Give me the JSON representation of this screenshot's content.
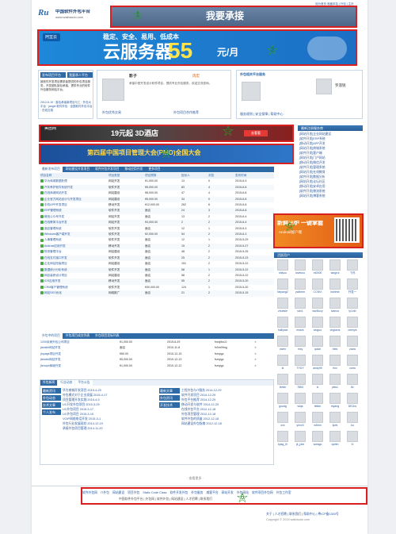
{
  "site": {
    "name": "中国软件外包平台",
    "domain": "www.waibaodo.com",
    "toplinks": "设为首页 收藏本站 | 外包 | 主页"
  },
  "ads": {
    "top_slogan": "我要承接",
    "cloud_brand": "阿里云",
    "cloud_tagline": "稳定、安全、易用、低成本",
    "cloud_main": "云服务器",
    "cloud_price": "55",
    "cloud_unit": "元/月",
    "banner1_brand": "美团网",
    "banner1_text": "19元起 3D酒店",
    "banner1_button": "去看看",
    "banner2_text": "第四届中国项目管理大会(PMO)全国大会",
    "side_ad_title": "新鲜出炉 一键掌握",
    "side_ad_sub": "Android客户端"
  },
  "left_intro": {
    "publish_button": "发布项目平台",
    "join_button": "我要承人平台",
    "intro_text": "致软件开发项目需求者提供的外包项目服务，开发团队接包承接，提供专业的软件外包服务网站平台。",
    "news_text": "2012-5-19 · 各包承接新项目与工 · 外包大平台 · jangel 软件外包 · 全国软件外包平台 · 在线交易"
  },
  "profile": {
    "title": "影子",
    "badge": "肉宏",
    "summary": "承接中型开发设计软件项目，提供专业外包服务，欢迎交流咨询。",
    "subtitle": "外包优秀交易",
    "subtitle2": "外包项目合作推荐"
  },
  "right_panel": {
    "header": "外包相关平台服务",
    "user_name": "罗淑锐",
    "footer_links": "服务规则 | 安全保障 | 帮助中心"
  },
  "tabs_main": [
    "最新发布项目",
    "网站建设开发项目",
    "软件外包开发项目",
    "移动应用开发",
    "更多项目"
  ],
  "project_table": {
    "headers": [
      "项目名称",
      "项目类型",
      "项目预算",
      "投标人",
      "浏览",
      "发布时间"
    ],
    "rows": [
      [
        "华为商城数据处理",
        "网站开发",
        "¥1,000.00",
        "13",
        "0",
        "2015-6-9"
      ],
      [
        "汽车养护软件系统开发",
        "软件开发",
        "¥5,000.00",
        "83",
        "4",
        "2015-6-8"
      ],
      [
        "在线商城网站开发",
        "网站建设",
        "¥8,000.00",
        "47",
        "4",
        "2015-6-8"
      ],
      [
        "企业官方网站设计与开发项目",
        "网站建设",
        "¥5,000.00",
        "34",
        "0",
        "2015-6-8"
      ],
      [
        "手机APP开发项目",
        "移动开发",
        "¥12,000.00",
        "262",
        "6",
        "2015-6-8"
      ],
      [
        "ERP管理系统",
        "软件开发",
        "面议",
        "24",
        "3",
        "2015-6-8"
      ],
      [
        "微信公众号开发",
        "网站开发",
        "面议",
        "13",
        "2",
        "2015-6-4"
      ],
      [
        "在线教育平台开发",
        "网站开发",
        "¥3,000.00",
        "2",
        "2",
        "2015-6-4"
      ],
      [
        "酒店管理系统",
        "软件开发",
        "面议",
        "12",
        "1",
        "2015-6-3"
      ],
      [
        "Windows客户端开发",
        "软件开发",
        "¥2,000.00",
        "54",
        "2",
        "2015-6-3"
      ],
      [
        "人事管理系统",
        "软件开发",
        "面议",
        "12",
        "1",
        "2015-5-29"
      ],
      [
        "Android应用开发",
        "移动开发",
        "面议",
        "15",
        "2",
        "2015-5-27"
      ],
      [
        "物流管理平台",
        "网站建设",
        "面议",
        "48",
        "2",
        "2015-5-25"
      ],
      [
        "在线支付接口开发",
        "软件开发",
        "面议",
        "25",
        "2",
        "2015-5-23"
      ],
      [
        "企业网站改版项目",
        "网站建设",
        "面议",
        "151",
        "2",
        "2015-5-22"
      ],
      [
        "数据统计分析系统",
        "软件开发",
        "面议",
        "58",
        "1",
        "2015-5-22"
      ],
      [
        "网店装修设计项目",
        "网站建设",
        "面议",
        "58",
        "2",
        "2015-5-22"
      ],
      [
        "iOS应用开发",
        "移动开发",
        "面议",
        "55",
        "2",
        "2015-5-20"
      ],
      [
        "CRM客户管理系统",
        "软件开发",
        "¥30,000.00",
        "124",
        "1",
        "2015-5-20"
      ],
      [
        "网站SEO优化",
        "网络推广",
        "面议",
        "21",
        "2",
        "2015-5-15"
      ]
    ]
  },
  "tabs_second": [
    "外包中的项目",
    "外包项目成交列表",
    "外包项目竞标列表"
  ],
  "small_table": {
    "rows": [
      [
        "1200余家外包公司项目",
        "¥1,000.00",
        "2015-6-29",
        "fxxzjlkoJJ"
      ],
      [
        "jiansite网站开发",
        "面议",
        "2010-11-8",
        "fx0m0fmg"
      ],
      [
        "jinpage项目开发",
        "¥50.00",
        "2010-12-15",
        "fsmpgc"
      ],
      [
        "jtsbcbk网站开发",
        "¥5,000.00",
        "2010-12-13",
        "fsmpgc"
      ],
      [
        "jfshopb商城开发",
        "¥1,000.00",
        "2010-12-12",
        "fsmpgc"
      ]
    ]
  },
  "news_panel": {
    "tabs": [
      "外包新闻",
      "行业动态",
      "平台公告"
    ],
    "left_cats": [
      "最新资讯",
      "外包动态",
      "技术文章",
      "个人发布"
    ],
    "left_items": [
      "华为商城开发项目 2015-4-29",
      "外包模式对于企业发展 2015-4-17",
      "项目管理开发实践 2015-4-5",
      "UC开发外包项目 2015-3-29",
      "UC外包项目 2015-3-17",
      "UC外包项目 2015-3-15",
      "VOIP网络电话开发 2015-3-1",
      "外包行业发展现状 2014-12-19",
      "承接外包项目管理 2014-11-20"
    ],
    "right_cats": [
      "最新文章",
      "外包资讯",
      "开发技术"
    ],
    "right_items": [
      "工程外包与IT服务 2014-12-29",
      "软件开发项目 2014-12-29",
      "外包平台推荐 2014-12-29",
      "移动开发与软件 2014-12-29",
      "在线外包平台 2012-12-18",
      "外包项目管理 2012-12-18",
      "软件外包的质量 2012-12-18",
      "网站建设外包指南 2012-12-18"
    ]
  },
  "right_links": [
    "[网站开发]企业网站建设",
    "[软件开发]ERP系统",
    "[移动开发]APP开发",
    "[网站开发]商城系统",
    "[软件开发]客户端",
    "[网站开发]门户网站",
    "[移动开发]微信开发",
    "[软件开发]管理系统",
    "[网站开发]在线教育",
    "[软件开发]数据分析",
    "[网站开发]论坛社区",
    "[移动开发]安卓应用",
    "[软件开发]物流系统",
    "[网站开发]博客系统"
  ],
  "right_list_header": "最新注册服务商",
  "user_grid_header": "活跃用户",
  "users": [
    "shiyuu",
    "lovekoo",
    "m0000",
    "tangrui",
    "飞鸟",
    "fatyang2",
    "yw6mm",
    "CCNVI",
    "kshimb",
    "开发一",
    "zhuesie",
    "sdv1",
    "ww3lucy",
    "ivanoo",
    "ly1vid",
    "huillywa",
    "ewsrs",
    "wuguo",
    "chgiavis",
    "chenys",
    "cwen",
    "mxy",
    "qokzi",
    "bbls",
    "zacw",
    "ki",
    "TYUY",
    "andy99",
    "rtxx",
    "czxw",
    "leelin",
    "7854",
    "lc",
    "ykw1",
    "8c",
    "goodg",
    "wiqs",
    "feifan",
    "myang",
    "DE2ov",
    "cxx",
    "yirxv3",
    "w5mn",
    "kpfs",
    "ku",
    "kpsg_lh",
    "jk_pkb",
    "wwsgo",
    "cjwtm",
    "l1"
  ],
  "footer": {
    "links": [
      "软件外包网",
      "IT外包",
      "网站建设",
      "项目外包",
      "Static Code Class",
      "软件开发外包",
      "外包服务",
      "威客平台",
      "网站开发",
      "外包网站",
      "软件项目外包网",
      "外包工作室"
    ],
    "links2": "中国软件外包平台 | 外包网 | 软件外包 | 网站建设 | 人才招聘 | 联系我们",
    "bottom": "关于 | 人才招聘 | 联系我们 | 帮助中心 | 粤ICP备1300号",
    "copyright": "Copyright © 2015 waibaodo.com",
    "page_hint": "· 查看更多 ·"
  },
  "annotations": [
    "1",
    "2",
    "3",
    "4",
    "5",
    "6"
  ]
}
